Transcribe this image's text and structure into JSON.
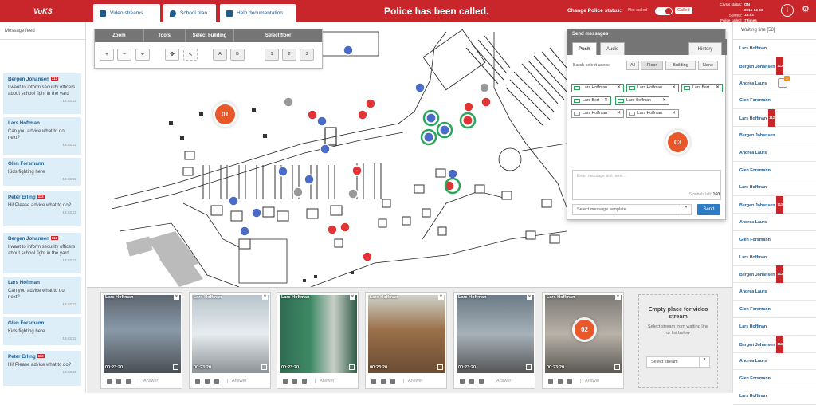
{
  "app": {
    "logo": "VoKS",
    "headline": "Police has been called."
  },
  "tabs": [
    {
      "label": "Video streams"
    },
    {
      "label": "School plan"
    },
    {
      "label": "Help documentation"
    }
  ],
  "police": {
    "label": "Change Police status:",
    "off_label": "Not called",
    "on_label": "Called"
  },
  "crisis": {
    "status_label": "Crysis status:",
    "status": "ON",
    "started_label": "Started:",
    "started": "2015-04-03 14:53",
    "called_label": "Police called:",
    "called": "7 times"
  },
  "message_feed": {
    "title": "Message feed",
    "badge": "112",
    "items": [
      {
        "name": "Bergen Johansen",
        "badge": true,
        "text": "I want to inform security officers about school fight in the yard",
        "time": "19:43:22"
      },
      {
        "name": "Lars Hoffman",
        "badge": false,
        "text": "Can you advice what to do next?",
        "time": "19:43:22"
      },
      {
        "name": "Glen Forsmann",
        "badge": false,
        "text": "Kids fighting here",
        "time": "19:43:22"
      },
      {
        "name": "Peter Erling",
        "badge": true,
        "text": "Hi! Please advice what to do?",
        "time": "19:43:22"
      },
      {
        "name": "Bergen Johansen",
        "badge": true,
        "text": "I want to inform security officers about school fight in the yard",
        "time": "19:43:22"
      },
      {
        "name": "Lars Hoffman",
        "badge": false,
        "text": "Can you advice what to do next?",
        "time": "19:43:22"
      },
      {
        "name": "Glen Forsmann",
        "badge": false,
        "text": "Kids fighting here",
        "time": "19:43:22"
      },
      {
        "name": "Peter Erling",
        "badge": true,
        "text": "Hi! Please advice what to do?",
        "time": "19:43:22"
      }
    ]
  },
  "controls": {
    "zoom": "Zoom",
    "tools": "Tools",
    "building": "Select building",
    "floor": "Select floor",
    "buildings": [
      "A",
      "B"
    ],
    "floors": [
      "1",
      "2",
      "3"
    ]
  },
  "send": {
    "title": "Send messages",
    "tabs": [
      "Push",
      "Audio"
    ],
    "history": "History",
    "batch_label": "Batch select users:",
    "batch": [
      "All",
      "Floor",
      "Building",
      "None"
    ],
    "chips": [
      "Lars Hoffman",
      "Lars Hoffman",
      "Lars Bert",
      "Lars Bert",
      "Lars Hoffman",
      "Lars Hoffman",
      "Lars Hoffman"
    ],
    "placeholder": "Enter message text here...",
    "symbols_label": "Symbols left:",
    "symbols": "160",
    "template": "Select message template",
    "send_label": "Send"
  },
  "markers": [
    "01",
    "02",
    "03"
  ],
  "waiting": {
    "title": "Waiting line [58]",
    "badge": "112",
    "icon_badge": "2",
    "items": [
      {
        "name": "Lars Hoffman",
        "badge": false
      },
      {
        "name": "Bergen Johansen",
        "badge": true
      },
      {
        "name": "Andrea Laurs",
        "badge": false
      },
      {
        "name": "Glen Forsmann",
        "badge": false
      },
      {
        "name": "Lars Hoffman",
        "badge": true
      },
      {
        "name": "Bergen Johansen",
        "badge": false
      },
      {
        "name": "Andrea Laurs",
        "badge": false
      },
      {
        "name": "Glen Forsmann",
        "badge": false
      },
      {
        "name": "Lars Hoffman",
        "badge": false
      },
      {
        "name": "Bergen Johansen",
        "badge": true
      },
      {
        "name": "Andrea Laurs",
        "badge": false
      },
      {
        "name": "Glen Forsmann",
        "badge": false
      },
      {
        "name": "Lars Hoffman",
        "badge": false
      },
      {
        "name": "Bergen Johansen",
        "badge": true
      },
      {
        "name": "Andrea Laurs",
        "badge": false
      },
      {
        "name": "Glen Forsmann",
        "badge": false
      },
      {
        "name": "Lars Hoffman",
        "badge": false
      },
      {
        "name": "Bergen Johansen",
        "badge": true
      },
      {
        "name": "Andrea Laurs",
        "badge": false
      },
      {
        "name": "Glen Forsmann",
        "badge": false
      },
      {
        "name": "Lars Hoffman",
        "badge": false
      }
    ]
  },
  "videos": [
    {
      "name": "Lars Hoffman",
      "time": "00:23:20"
    },
    {
      "name": "Lars Hoffman",
      "time": "00:23:20"
    },
    {
      "name": "Lars Hoffman",
      "time": "00:23:20"
    },
    {
      "name": "Lars Hoffman",
      "time": "00:23:20"
    },
    {
      "name": "Lars Hoffman",
      "time": "00:23:20"
    },
    {
      "name": "Lars Hoffman",
      "time": "00:23:20"
    }
  ],
  "answer_label": "Answer",
  "empty": {
    "title": "Empty place for video stream",
    "desc": "Select stream from waiting line or list below",
    "select": "Select stream"
  }
}
